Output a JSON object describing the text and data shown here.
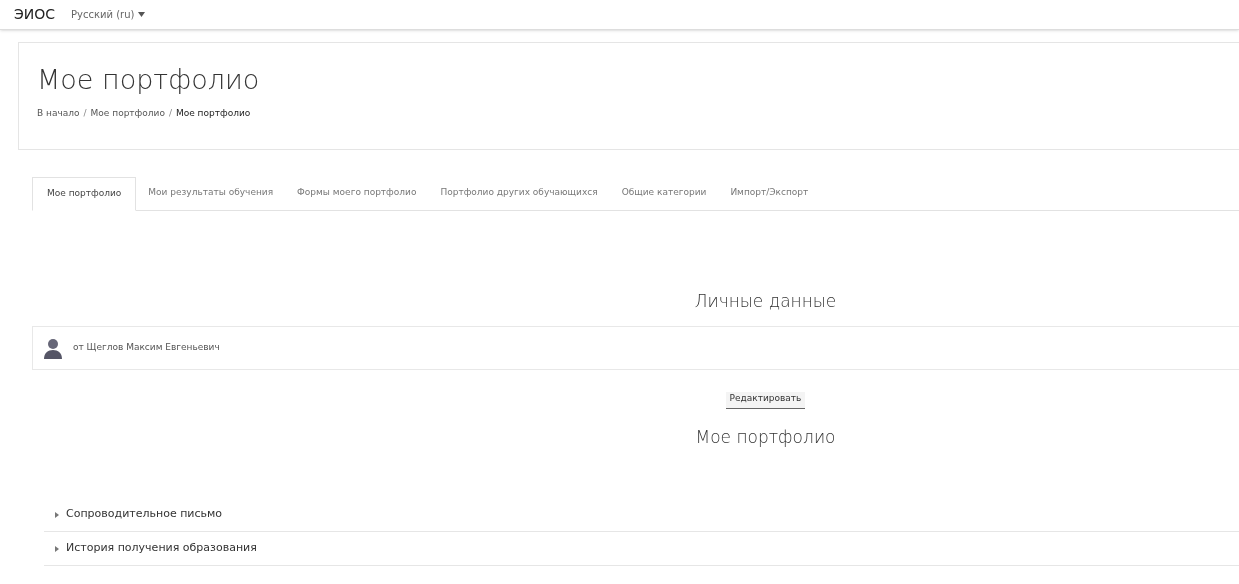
{
  "navbar": {
    "brand": "ЭИОС",
    "language": "Русский (ru)"
  },
  "header": {
    "title": "Мое портфолио",
    "breadcrumb": [
      "В начало",
      "Мое портфолио",
      "Мое портфолио"
    ],
    "breadcrumb_separators": [
      "/",
      "/"
    ]
  },
  "tabs": [
    {
      "label": "Мое портфолио",
      "selected": true
    },
    {
      "label": "Мои результаты обучения",
      "selected": false
    },
    {
      "label": "Формы моего портфолио",
      "selected": false
    },
    {
      "label": "Портфолио других обучающихся",
      "selected": false
    },
    {
      "label": "Общие категории",
      "selected": false
    },
    {
      "label": "Импорт/Экспорт",
      "selected": false
    }
  ],
  "personal": {
    "heading": "Личные данные",
    "author": "от Щеглов Максим Евгеньевич",
    "edit_button": "Редактировать"
  },
  "portfolio": {
    "heading": "Мое портфолио",
    "sections": [
      {
        "label": "Сопроводительное письмо",
        "expanded": false
      },
      {
        "label": "История получения образования",
        "expanded": false
      }
    ]
  }
}
